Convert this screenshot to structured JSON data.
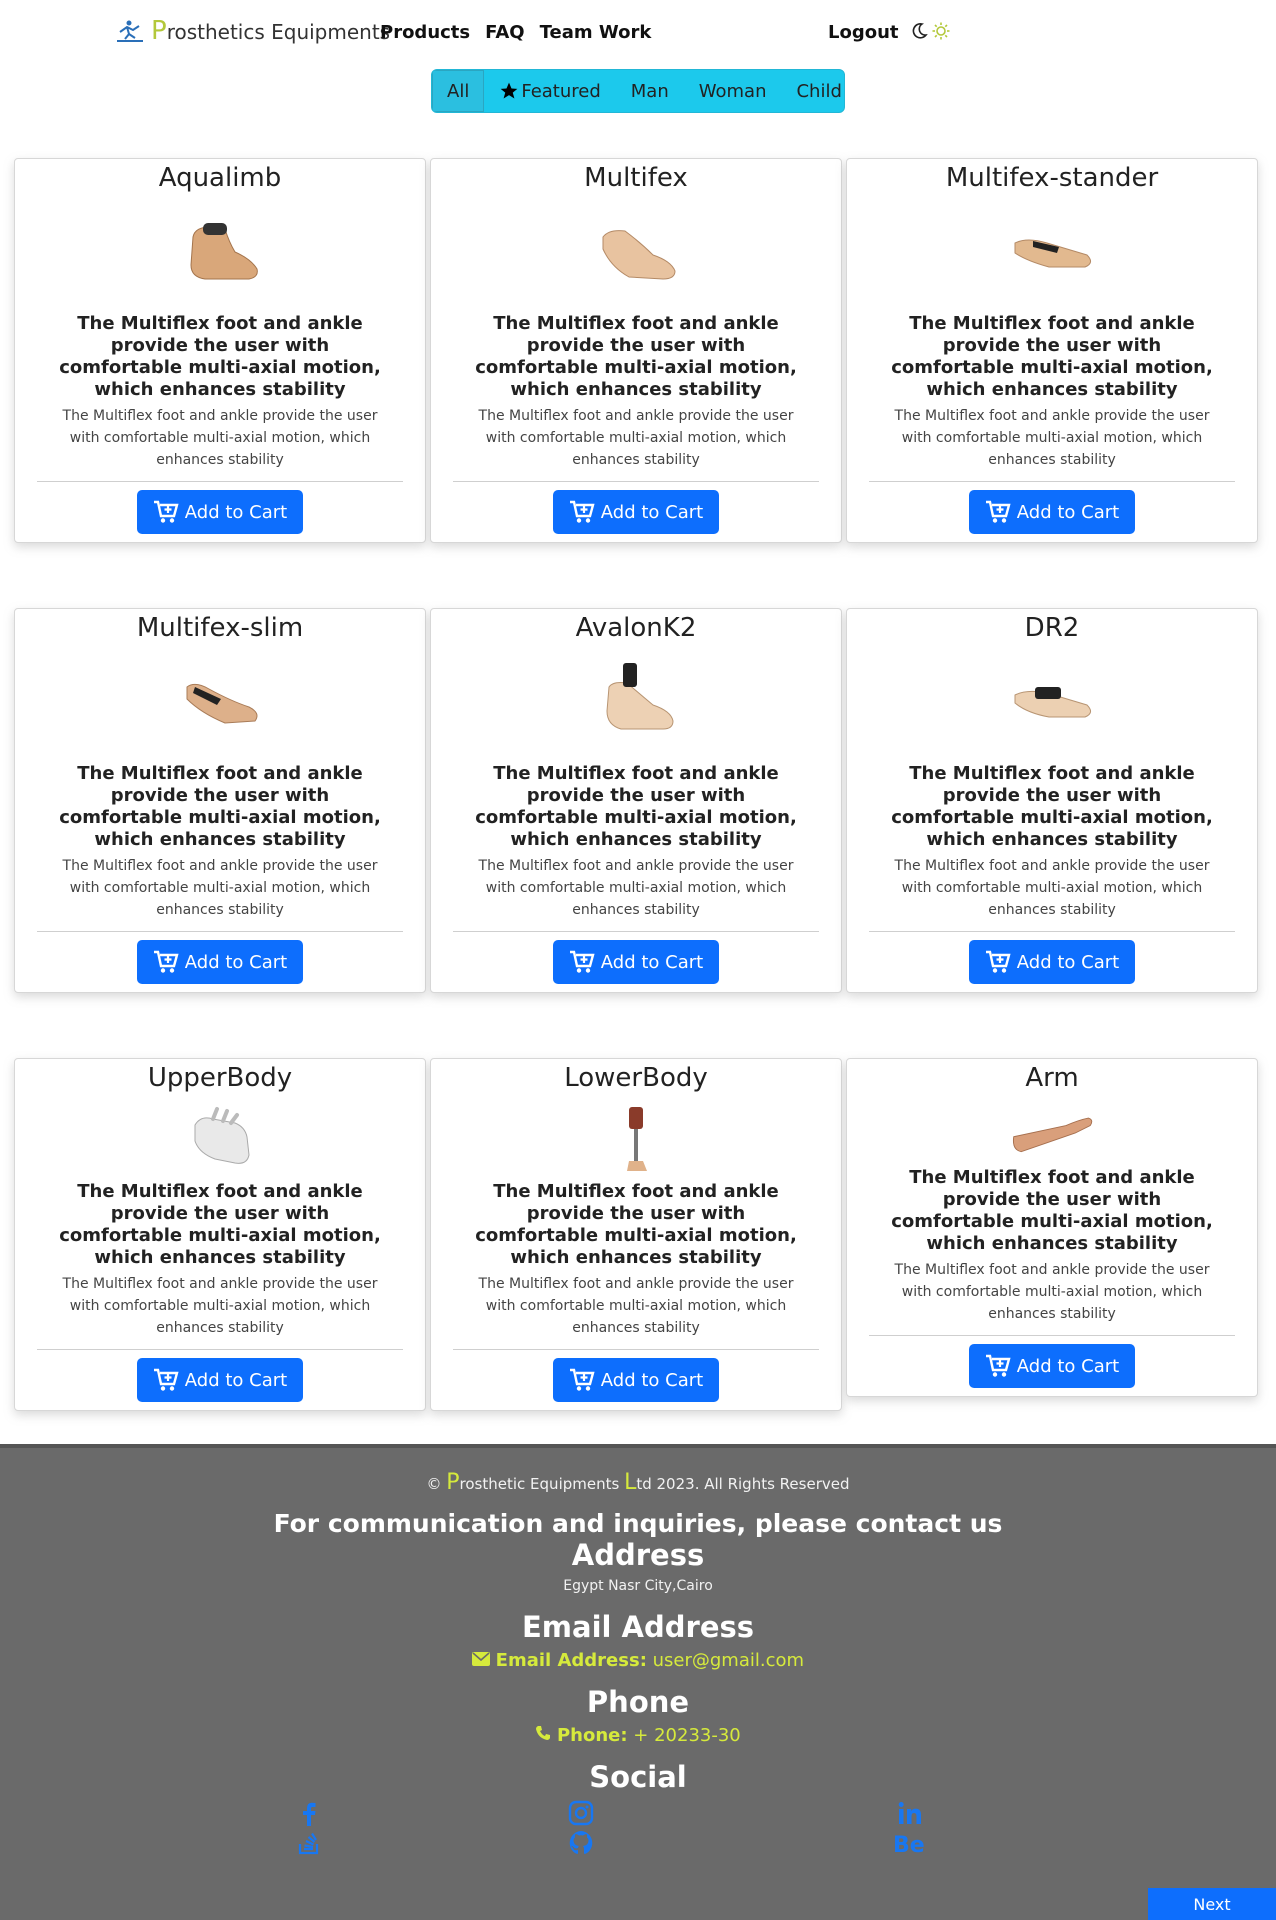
{
  "brand": {
    "first_letter": "P",
    "rest": "rosthetics Equipments"
  },
  "nav": {
    "products": "Products",
    "faq": "FAQ",
    "team": "Team Work",
    "logout": "Logout"
  },
  "filter": {
    "all": "All",
    "featured": "Featured",
    "man": "Man",
    "woman": "Woman",
    "child": "Child"
  },
  "card_text": {
    "bold": "The Multiflex foot and ankle provide the user with comfortable multi-axial motion, which enhances stability",
    "body": "The Multiflex foot and ankle provide the user with comfortable multi-axial motion, which enhances stability",
    "button": "Add to Cart"
  },
  "products": [
    {
      "name": "Aqualimb"
    },
    {
      "name": "Multifex"
    },
    {
      "name": "Multifex-stander"
    },
    {
      "name": "Multifex-slim"
    },
    {
      "name": "AvalonK2"
    },
    {
      "name": "DR2"
    },
    {
      "name": "UpperBody"
    },
    {
      "name": "LowerBody"
    },
    {
      "name": "Arm"
    }
  ],
  "footer": {
    "copy_p": "P",
    "copy_mid": "rosthetic Equipments ",
    "copy_l": "L",
    "copy_end": "td 2023. All Rights Reserved",
    "contact": "For communication and inquiries, please contact us",
    "address_h": "Address",
    "address": "Egypt Nasr City,Cairo",
    "email_h": "Email Address",
    "email_label": "Email Address:",
    "email": "user@gmail.com",
    "phone_h": "Phone",
    "phone_label": "Phone:",
    "phone": "+ 20233-30",
    "social_h": "Social"
  },
  "next": "Next",
  "colors": {
    "accent": "#0d6efd",
    "filter_bg": "#1cc9ec",
    "brand_letter": "#b3c83a",
    "footer_bg": "#6a6a6a",
    "footer_link": "#d6ea3c"
  }
}
